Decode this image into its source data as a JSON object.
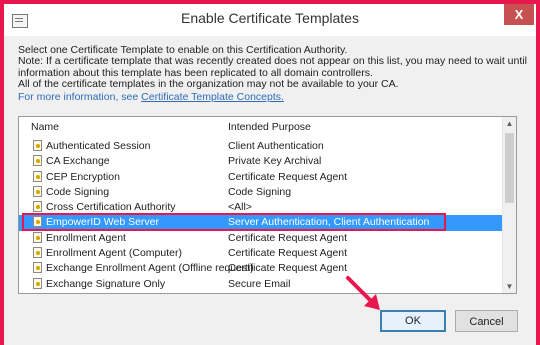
{
  "window": {
    "title": "Enable Certificate Templates",
    "close_glyph": "X"
  },
  "description": {
    "lines": [
      "Select one Certificate Template to enable on this Certification Authority.",
      "Note: If a certificate template that was recently created does not appear on this list, you may need to wait until",
      "information about this template has been replicated to all domain controllers.",
      "All of the certificate templates in the organization may not be available to your CA."
    ],
    "more_info_prefix": "For more information, see",
    "link_text": "Certificate Template Concepts.",
    "link_color": "#2f6bb7"
  },
  "list": {
    "columns": {
      "name": "Name",
      "purpose": "Intended Purpose"
    },
    "rows": [
      {
        "name": "Authenticated Session",
        "purpose": "Client Authentication",
        "icon": "certificate-template-icon"
      },
      {
        "name": "CA Exchange",
        "purpose": "Private Key Archival",
        "icon": "certificate-template-icon"
      },
      {
        "name": "CEP Encryption",
        "purpose": "Certificate Request Agent",
        "icon": "certificate-template-icon"
      },
      {
        "name": "Code Signing",
        "purpose": "Code Signing",
        "icon": "certificate-template-icon"
      },
      {
        "name": "Cross Certification Authority",
        "purpose": "<All>",
        "icon": "certificate-template-icon"
      },
      {
        "name": "EmpowerID Web Server",
        "purpose": "Server Authentication, Client Authentication",
        "icon": "certificate-template-icon",
        "selected": true
      },
      {
        "name": "Enrollment Agent",
        "purpose": "Certificate Request Agent",
        "icon": "certificate-template-icon"
      },
      {
        "name": "Enrollment Agent (Computer)",
        "purpose": "Certificate Request Agent",
        "icon": "certificate-template-icon"
      },
      {
        "name": "Exchange Enrollment Agent (Offline request)",
        "purpose": "Certificate Request Agent",
        "icon": "certificate-template-icon"
      },
      {
        "name": "Exchange Signature Only",
        "purpose": "Secure Email",
        "icon": "certificate-template-icon"
      }
    ],
    "selection_color": "#3399ff",
    "highlight_outline_color": "#e8174e"
  },
  "buttons": {
    "ok": "OK",
    "cancel": "Cancel"
  },
  "colors": {
    "frame_border": "#e8174e",
    "arrow": "#e8174e",
    "dialog_background": "#f0f0f0"
  }
}
